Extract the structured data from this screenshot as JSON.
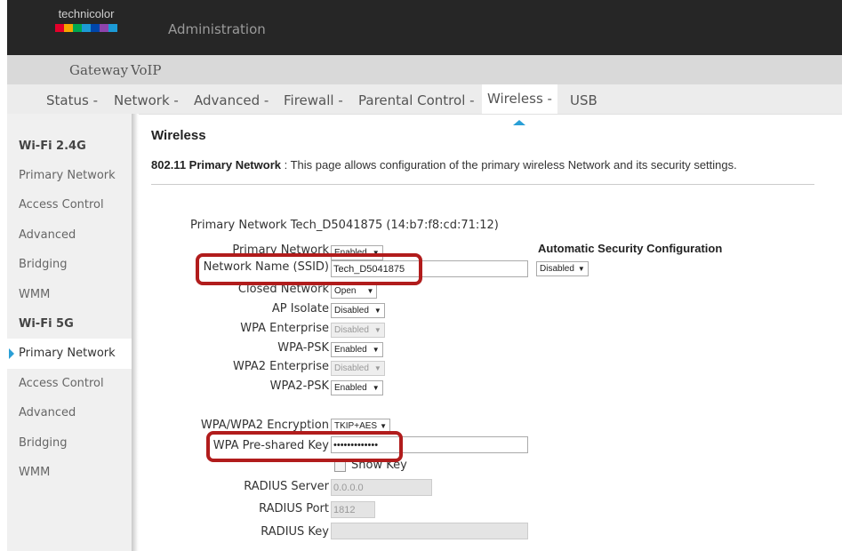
{
  "header": {
    "logo_text": "technicolor",
    "logo_colors": [
      "#e4002b",
      "#f7a600",
      "#00a650",
      "#1c9ad6",
      "#0047ab",
      "#8e44ad",
      "#1c9ad6"
    ],
    "section_title": "Administration"
  },
  "primary_nav": [
    "Gateway",
    "VoIP"
  ],
  "secondary_nav": {
    "items": [
      "Status -",
      "Network -",
      "Advanced -",
      "Firewall -",
      "Parental Control -",
      "Wireless -",
      "USB"
    ],
    "active": "Wireless -",
    "accent": "#2a9fd6"
  },
  "sidebar": {
    "wifi24_header": "Wi-Fi 2.4G",
    "wifi24_items": [
      "Primary Network",
      "Access Control",
      "Advanced",
      "Bridging",
      "WMM"
    ],
    "wifi5_header": "Wi-Fi 5G",
    "wifi5_items": [
      "Primary Network",
      "Access Control",
      "Advanced",
      "Bridging",
      "WMM"
    ],
    "active": "Primary Network"
  },
  "main": {
    "title": "Wireless",
    "desc_bold": "802.11 Primary Network",
    "desc_text": " :  This page allows configuration of the primary wireless Network and its security settings.",
    "network_info": "Primary Network Tech_D5041875 (14:b7:f8:cd:71:12)"
  },
  "form": {
    "primary_network": {
      "label": "Primary Network",
      "value": "Enabled"
    },
    "ssid": {
      "label": "Network Name (SSID)",
      "value": "Tech_D5041875"
    },
    "closed_network": {
      "label": "Closed Network",
      "value": "Open"
    },
    "ap_isolate": {
      "label": "AP Isolate",
      "value": "Disabled"
    },
    "wpa_enterprise": {
      "label": "WPA Enterprise",
      "value": "Disabled"
    },
    "wpa_psk": {
      "label": "WPA-PSK",
      "value": "Enabled"
    },
    "wpa2_enterprise": {
      "label": "WPA2 Enterprise",
      "value": "Disabled"
    },
    "wpa2_psk": {
      "label": "WPA2-PSK",
      "value": "Enabled"
    },
    "encryption": {
      "label": "WPA/WPA2 Encryption",
      "value": "TKIP+AES"
    },
    "psk": {
      "label": "WPA Pre-shared Key",
      "value": "•••••••••••••"
    },
    "show_key": {
      "label": "Show Key"
    },
    "radius_server": {
      "label": "RADIUS Server",
      "value": "0.0.0.0"
    },
    "radius_port": {
      "label": "RADIUS Port",
      "value": "1812"
    },
    "radius_key": {
      "label": "RADIUS Key",
      "value": ""
    }
  },
  "auto_security": {
    "title": "Automatic Security Configuration",
    "value": "Disabled"
  },
  "highlight_color": "#b11c1c"
}
